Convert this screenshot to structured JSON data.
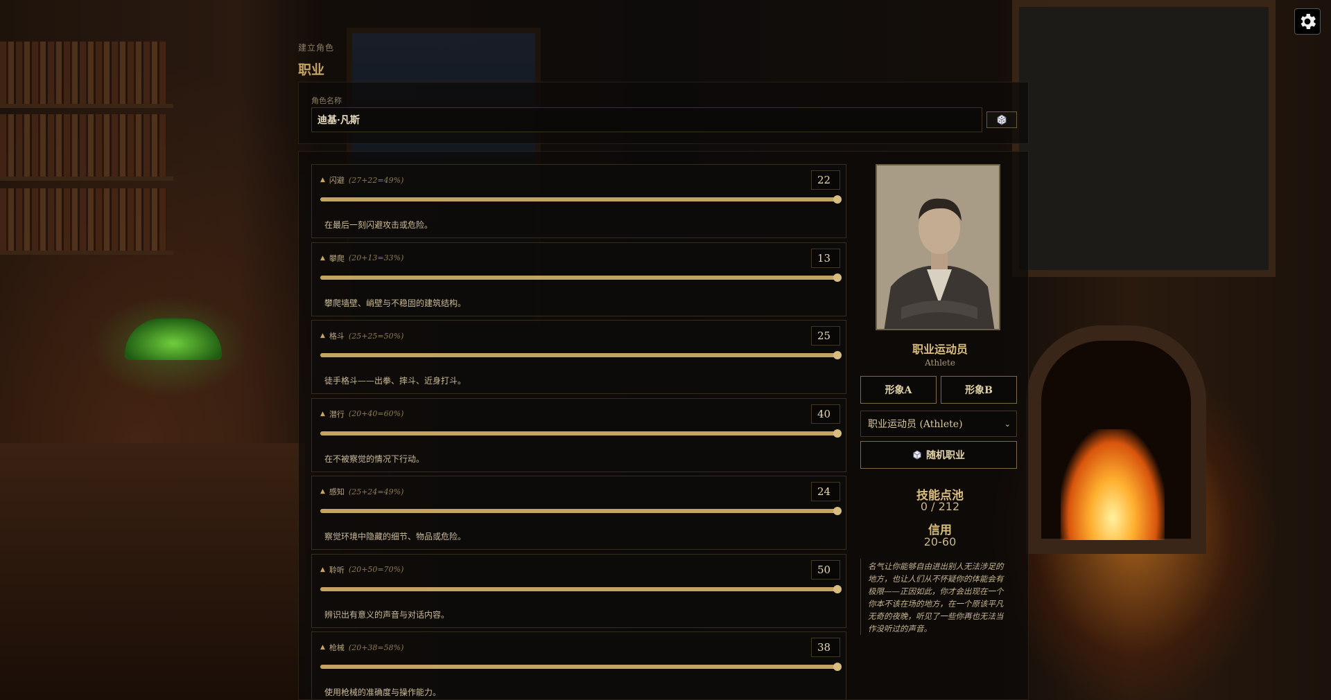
{
  "header": {
    "subtitle": "建立角色",
    "title": "职业"
  },
  "character": {
    "name_label": "角色名称",
    "name_value": "迪基·凡斯",
    "dice_icon": "dice-icon"
  },
  "skills": [
    {
      "name": "闪避",
      "formula": "(27+22=49%)",
      "value": "22",
      "level": 1.0,
      "description": "在最后一刻闪避攻击或危险。"
    },
    {
      "name": "攀爬",
      "formula": "(20+13=33%)",
      "value": "13",
      "level": 1.0,
      "description": "攀爬墙壁、峭壁与不稳固的建筑结构。"
    },
    {
      "name": "格斗",
      "formula": "(25+25=50%)",
      "value": "25",
      "level": 1.0,
      "description": "徒手格斗——出拳、摔斗、近身打斗。"
    },
    {
      "name": "潜行",
      "formula": "(20+40=60%)",
      "value": "40",
      "level": 1.0,
      "description": "在不被察觉的情况下行动。"
    },
    {
      "name": "感知",
      "formula": "(25+24=49%)",
      "value": "24",
      "level": 1.0,
      "description": "察觉环境中隐藏的细节、物品或危险。"
    },
    {
      "name": "聆听",
      "formula": "(20+50=70%)",
      "value": "50",
      "level": 1.0,
      "description": "辨识出有意义的声音与对话内容。"
    },
    {
      "name": "枪械",
      "formula": "(20+38=58%)",
      "value": "38",
      "level": 1.0,
      "description": "使用枪械的准确度与操作能力。"
    }
  ],
  "occupation": {
    "name": "职业运动员",
    "name_en": "Athlete",
    "look_a": "形象A",
    "look_b": "形象B",
    "selected": "职业运动员 (Athlete)",
    "random_label": "随机职业",
    "skill_pool_label": "技能点池",
    "skill_pool_value": "0 / 212",
    "credit_label": "信用",
    "credit_value": "20-60",
    "description": "名气让你能够自由进出别人无法涉足的地方，也让人们从不怀疑你的体能会有极限——正因如此，你才会出现在一个你本不该在场的地方，在一个原该平凡无奇的夜晚，听见了一些你再也无法当作没听过的声音。"
  },
  "colors": {
    "accent": "#c9a564",
    "slider_fill": "#c3a462",
    "panel_bg": "#0c0a08"
  },
  "icons": {
    "settings": "gear-icon",
    "dice": "dice-icon",
    "dropdown": "chevron-down-icon",
    "expand": "triangle-up-icon"
  }
}
